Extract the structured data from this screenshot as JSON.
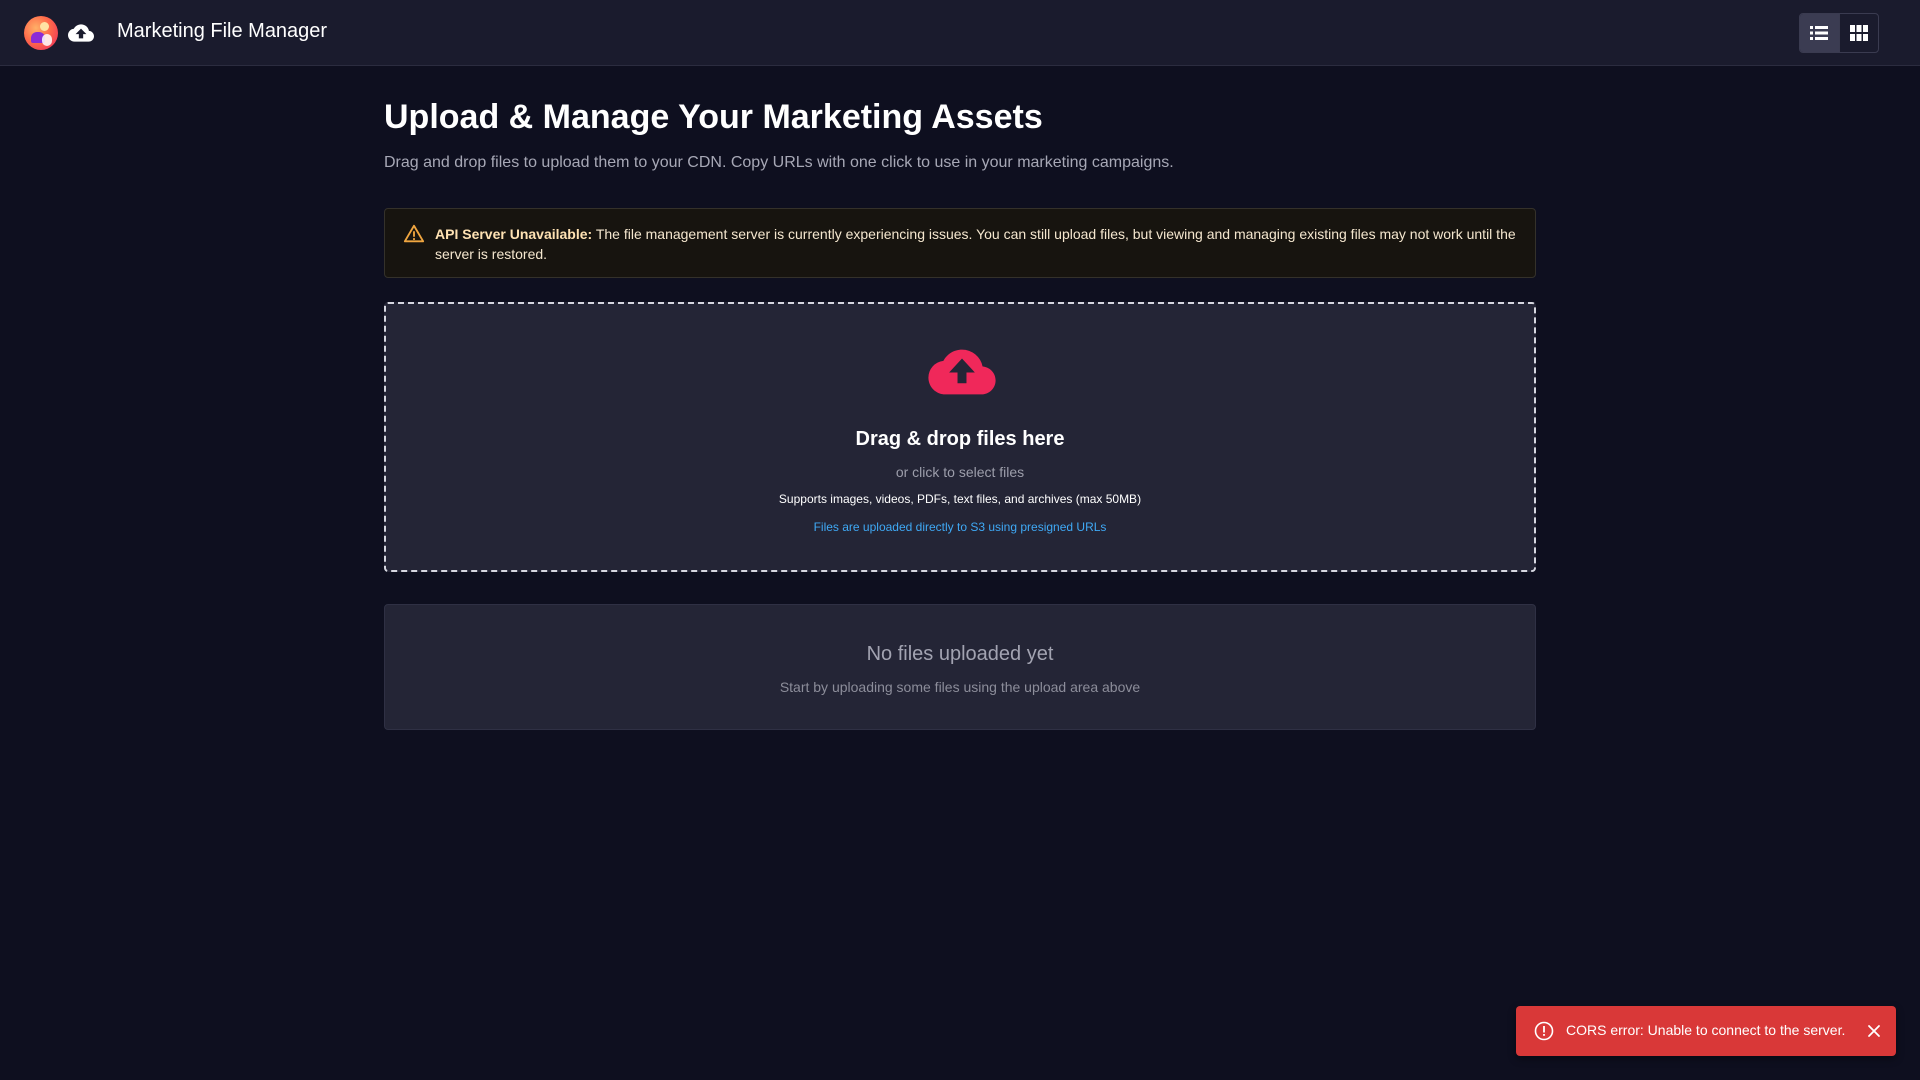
{
  "header": {
    "app_title": "Marketing File Manager",
    "logo_icon": "app-logo",
    "cloud_icon": "cloud-upload-icon",
    "view_toggle": [
      {
        "name": "list-view",
        "icon": "list-icon",
        "active": true
      },
      {
        "name": "grid-view",
        "icon": "grid-icon",
        "active": false
      }
    ]
  },
  "main": {
    "title": "Upload & Manage Your Marketing Assets",
    "subtitle": "Drag and drop files to upload them to your CDN. Copy URLs with one click to use in your marketing campaigns."
  },
  "warning": {
    "icon": "warning-triangle-icon",
    "label": "API Server Unavailable:",
    "message": " The file management server is currently experiencing issues. You can still upload files, but viewing and managing existing files may not work until the server is restored.",
    "color": "#f0a640"
  },
  "dropzone": {
    "icon": "cloud-upload-icon",
    "icon_color": "#f0285a",
    "title": "Drag & drop files here",
    "or_text": "or click to select files",
    "supports_text": "Supports images, videos, PDFs, text files, and archives (max 50MB)",
    "info_text": "Files are uploaded directly to S3 using presigned URLs"
  },
  "file_list": {
    "empty_title": "No files uploaded yet",
    "empty_subtitle": "Start by uploading some files using the upload area above"
  },
  "toast": {
    "icon": "error-circle-icon",
    "message": "CORS error: Unable to connect to the server.",
    "close_icon": "close-icon",
    "color": "#d93838"
  }
}
